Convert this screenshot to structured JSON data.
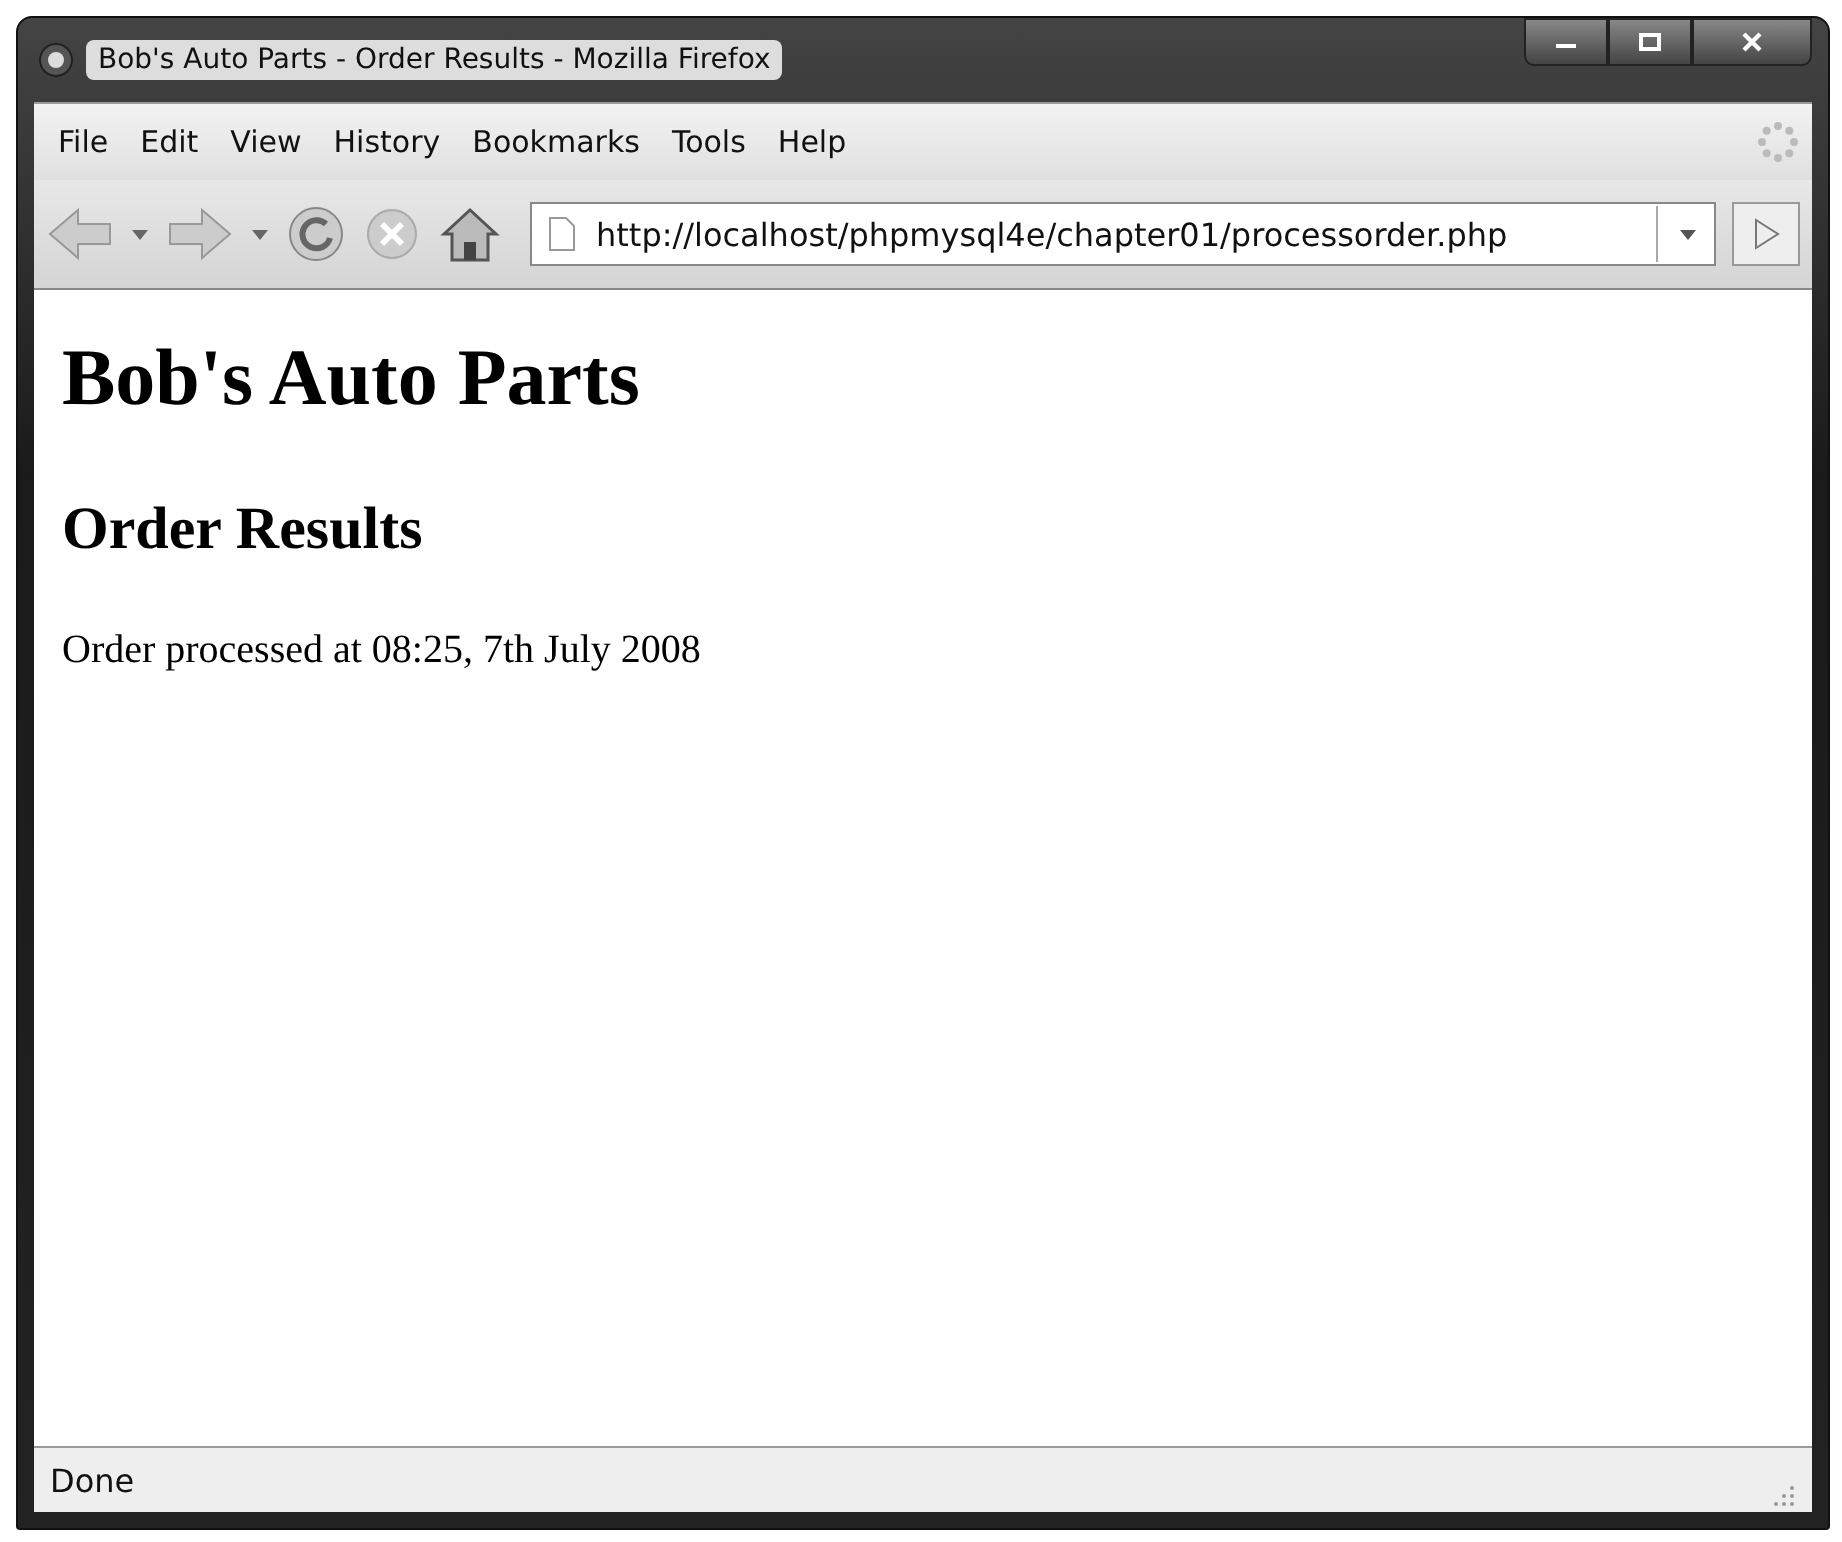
{
  "window": {
    "title": "Bob's Auto Parts - Order Results - Mozilla Firefox"
  },
  "menu": [
    {
      "label": "File"
    },
    {
      "label": "Edit"
    },
    {
      "label": "View"
    },
    {
      "label": "History"
    },
    {
      "label": "Bookmarks"
    },
    {
      "label": "Tools"
    },
    {
      "label": "Help"
    }
  ],
  "address_bar": {
    "value": "http://localhost/phpmysql4e/chapter01/processorder.php"
  },
  "page": {
    "heading": "Bob's Auto Parts",
    "subheading": "Order Results",
    "text": "Order processed at 08:25, 7th July 2008"
  },
  "status_bar": {
    "text": "Done"
  }
}
